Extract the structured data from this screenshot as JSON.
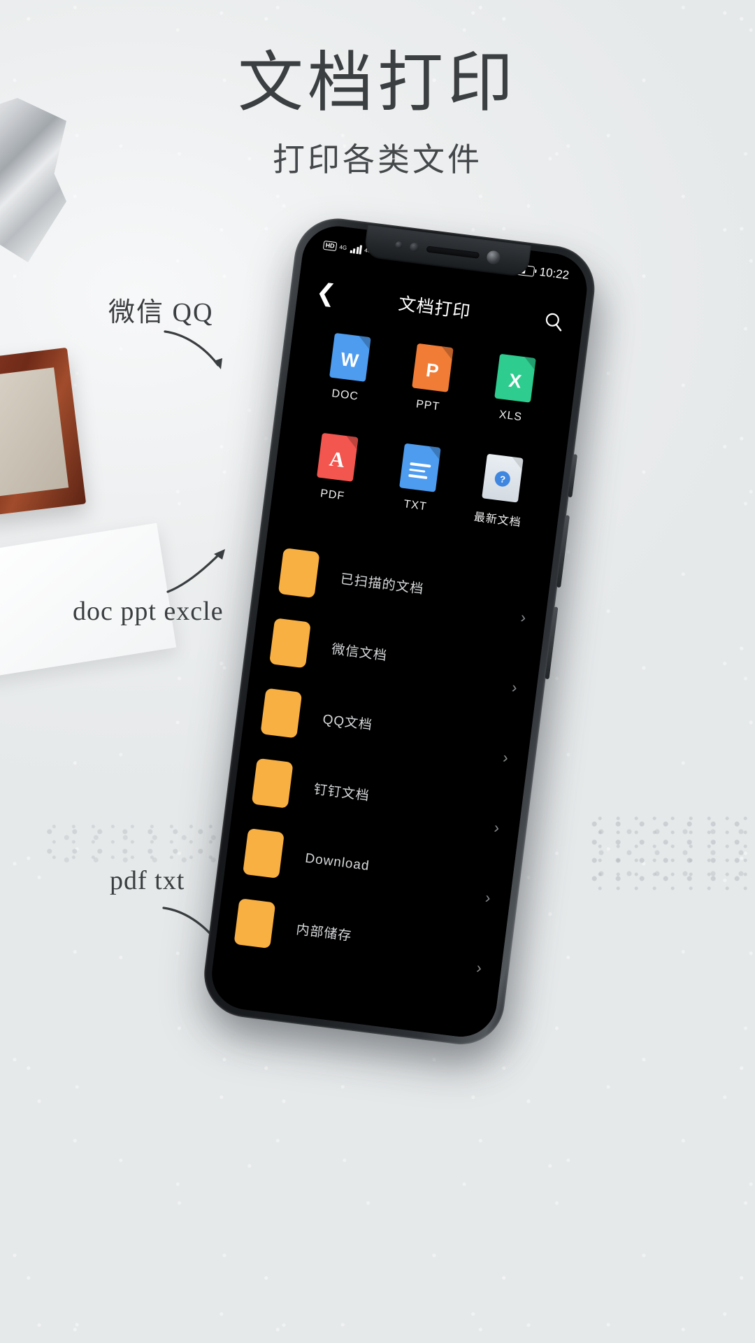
{
  "poster": {
    "headline": "文档打印",
    "subhead": "打印各类文件",
    "annotations": [
      {
        "text": "微信  QQ"
      },
      {
        "text": "doc  ppt  excle"
      },
      {
        "text": "pdf   txt"
      }
    ]
  },
  "phone": {
    "statusbar": {
      "hd_badge": "HD",
      "net1": "4G",
      "net2": "4G",
      "time": "10:22"
    },
    "navbar": {
      "back_icon": "chevron-left-icon",
      "title": "文档打印",
      "search_icon": "search-icon"
    },
    "grid": [
      {
        "label": "DOC",
        "glyph": "W",
        "color": "#4d9cf0",
        "kind": "letter"
      },
      {
        "label": "PPT",
        "glyph": "P",
        "color": "#f07c36",
        "kind": "letter"
      },
      {
        "label": "XLS",
        "glyph": "X",
        "color": "#2ecc8f",
        "kind": "letter"
      },
      {
        "label": "PDF",
        "glyph": "A",
        "color": "#f2564f",
        "kind": "pdf"
      },
      {
        "label": "TXT",
        "glyph": "",
        "color": "#4d9cf0",
        "kind": "lines"
      },
      {
        "label": "最新文档",
        "glyph": "?",
        "color": "#dfe5ea",
        "kind": "recent"
      }
    ],
    "folders": [
      {
        "name": "已扫描的文档",
        "color": "#f9b042"
      },
      {
        "name": "微信文档",
        "color": "#f9b042"
      },
      {
        "name": "QQ文档",
        "color": "#f9b042"
      },
      {
        "name": "钉钉文档",
        "color": "#f9b042"
      },
      {
        "name": "Download",
        "color": "#f9b042"
      },
      {
        "name": "内部储存",
        "color": "#f9b042"
      }
    ],
    "chevron": "›"
  }
}
